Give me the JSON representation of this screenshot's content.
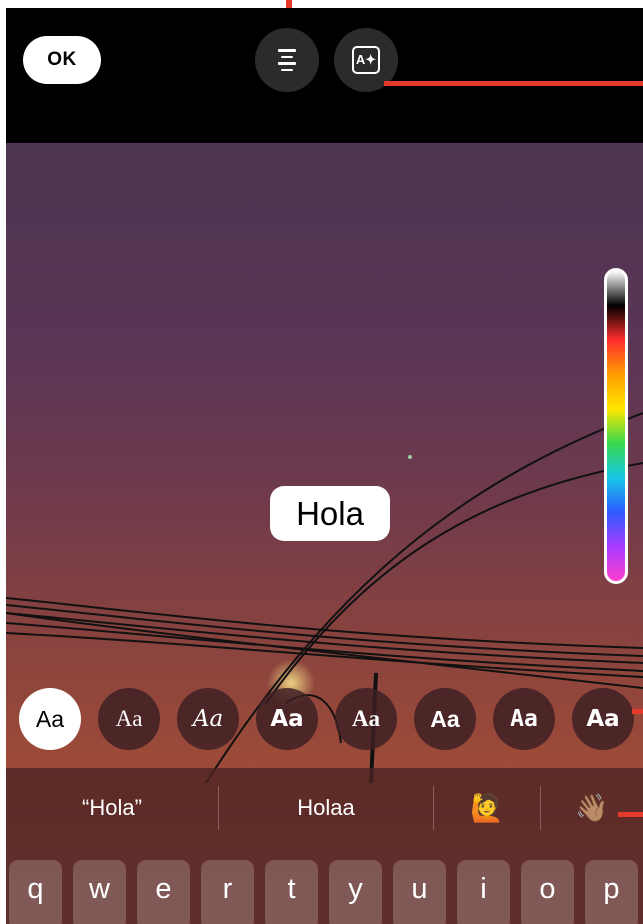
{
  "top_bar": {
    "ok_label": "OK",
    "effect_icon_glyph": "A✦"
  },
  "text_sticker": "Hola",
  "font_styles": [
    {
      "label": "Aa",
      "icon": "font-classic",
      "selected": true
    },
    {
      "label": "Aa",
      "icon": "font-serif"
    },
    {
      "label": "Aa",
      "icon": "font-script"
    },
    {
      "label": "Aa",
      "icon": "font-modern-bold"
    },
    {
      "label": "Aa",
      "icon": "font-typewriter"
    },
    {
      "label": "Aa",
      "icon": "font-strong"
    },
    {
      "label": "Aa",
      "icon": "font-slab"
    },
    {
      "label": "Aa",
      "icon": "font-rounded"
    }
  ],
  "suggestions": {
    "quoted": "“Hola”",
    "second": "Holaa",
    "emoji_1": "🙋",
    "emoji_2": "👋🏽"
  },
  "keyboard_row": [
    "q",
    "w",
    "e",
    "r",
    "t",
    "y",
    "u",
    "i",
    "o",
    "p"
  ],
  "color_picker": {
    "gradient": [
      "#ffffff",
      "#000000",
      "#ff2d2d",
      "#ff9d00",
      "#ffe600",
      "#37d84d",
      "#17c7e6",
      "#2e5bff",
      "#a83bff",
      "#ff3fd0"
    ]
  },
  "annotation_color": "#e53a2b"
}
